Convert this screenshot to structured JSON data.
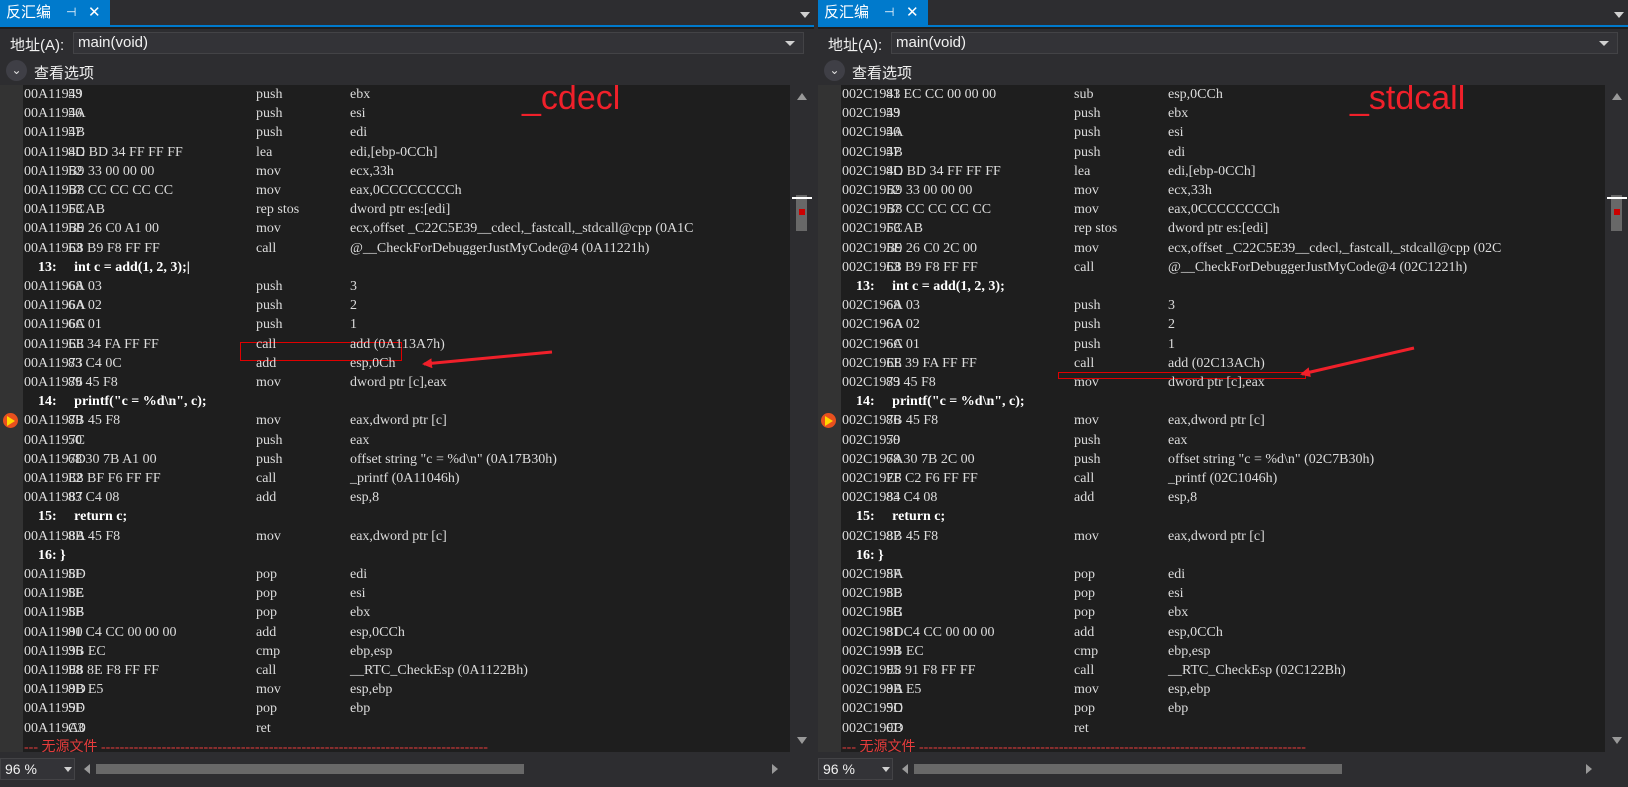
{
  "panes": [
    {
      "tab_title": "反汇编",
      "tab_pin": "⊣",
      "tab_close": "✕",
      "address_label": "地址(A):",
      "address_value": "main(void)",
      "view_options_label": "查看选项",
      "calling_convention": "_cdecl",
      "zoom": "96 %",
      "lines": [
        {
          "a": "00A11949",
          "b": "53",
          "m": "push",
          "o": "ebx"
        },
        {
          "a": "00A1194A",
          "b": "56",
          "m": "push",
          "o": "esi"
        },
        {
          "a": "00A1194B",
          "b": "57",
          "m": "push",
          "o": "edi"
        },
        {
          "a": "00A1194C",
          "b": "8D BD 34 FF FF FF",
          "m": "lea",
          "o": "edi,[ebp-0CCh]"
        },
        {
          "a": "00A11952",
          "b": "B9 33 00 00 00",
          "m": "mov",
          "o": "ecx,33h"
        },
        {
          "a": "00A11957",
          "b": "B8 CC CC CC CC",
          "m": "mov",
          "o": "eax,0CCCCCCCCh"
        },
        {
          "a": "00A1195C",
          "b": "F3 AB",
          "m": "rep stos",
          "o": "dword ptr es:[edi]"
        },
        {
          "a": "00A1195E",
          "b": "B9 26 C0 A1 00",
          "m": "mov",
          "o": "ecx,offset _C22C5E39__cdecl,_fastcall,_stdcall@cpp (0A1C"
        },
        {
          "a": "00A11963",
          "b": "E8 B9 F8 FF FF",
          "m": "call",
          "o": "@__CheckForDebuggerJustMyCode@4 (0A11221h)"
        },
        {
          "src": "    13:     int c = add(1, 2, 3);|"
        },
        {
          "a": "00A11968",
          "b": "6A 03",
          "m": "push",
          "o": "3"
        },
        {
          "a": "00A1196A",
          "b": "6A 02",
          "m": "push",
          "o": "2"
        },
        {
          "a": "00A1196C",
          "b": "6A 01",
          "m": "push",
          "o": "1"
        },
        {
          "a": "00A1196E",
          "b": "E8 34 FA FF FF",
          "m": "call",
          "o": "add (0A113A7h)"
        },
        {
          "a": "00A11973",
          "b": "83 C4 0C",
          "m": "add",
          "o": "esp,0Ch"
        },
        {
          "a": "00A11976",
          "b": "89 45 F8",
          "m": "mov",
          "o": "dword ptr [c],eax"
        },
        {
          "src": "    14:     printf(\"c = %d\\n\", c);"
        },
        {
          "a": "00A11979",
          "b": "8B 45 F8",
          "m": "mov",
          "o": "eax,dword ptr [c]",
          "bp": true
        },
        {
          "a": "00A1197C",
          "b": "50",
          "m": "push",
          "o": "eax"
        },
        {
          "a": "00A1197D",
          "b": "68 30 7B A1 00",
          "m": "push",
          "o": "offset string \"c = %d\\n\" (0A17B30h)"
        },
        {
          "a": "00A11982",
          "b": "E8 BF F6 FF FF",
          "m": "call",
          "o": "_printf (0A11046h)"
        },
        {
          "a": "00A11987",
          "b": "83 C4 08",
          "m": "add",
          "o": "esp,8"
        },
        {
          "src": "    15:     return c;"
        },
        {
          "a": "00A1198A",
          "b": "8B 45 F8",
          "m": "mov",
          "o": "eax,dword ptr [c]"
        },
        {
          "src": "    16: }"
        },
        {
          "a": "00A1198D",
          "b": "5F",
          "m": "pop",
          "o": "edi"
        },
        {
          "a": "00A1198E",
          "b": "5E",
          "m": "pop",
          "o": "esi"
        },
        {
          "a": "00A1198F",
          "b": "5B",
          "m": "pop",
          "o": "ebx"
        },
        {
          "a": "00A11990",
          "b": "81 C4 CC 00 00 00",
          "m": "add",
          "o": "esp,0CCh"
        },
        {
          "a": "00A11996",
          "b": "3B EC",
          "m": "cmp",
          "o": "ebp,esp"
        },
        {
          "a": "00A11998",
          "b": "E8 8E F8 FF FF",
          "m": "call",
          "o": "__RTC_CheckEsp (0A1122Bh)"
        },
        {
          "a": "00A1199D",
          "b": "8B E5",
          "m": "mov",
          "o": "esp,ebp"
        },
        {
          "a": "00A1199F",
          "b": "5D",
          "m": "pop",
          "o": "ebp"
        },
        {
          "a": "00A119A0",
          "b": "C3",
          "m": "ret",
          "o": ""
        },
        {
          "nosrc": "--- 无源文件 -----------------------------------------------------------------------------------"
        }
      ]
    },
    {
      "tab_title": "反汇编",
      "tab_pin": "⊣",
      "tab_close": "✕",
      "address_label": "地址(A):",
      "address_value": "main(void)",
      "view_options_label": "查看选项",
      "calling_convention": "_stdcall",
      "zoom": "96 %",
      "lines": [
        {
          "a": "002C1943",
          "b": "81 EC CC 00 00 00",
          "m": "sub",
          "o": "esp,0CCh"
        },
        {
          "a": "002C1949",
          "b": "53",
          "m": "push",
          "o": "ebx"
        },
        {
          "a": "002C194A",
          "b": "56",
          "m": "push",
          "o": "esi"
        },
        {
          "a": "002C194B",
          "b": "57",
          "m": "push",
          "o": "edi"
        },
        {
          "a": "002C194C",
          "b": "8D BD 34 FF FF FF",
          "m": "lea",
          "o": "edi,[ebp-0CCh]"
        },
        {
          "a": "002C1952",
          "b": "B9 33 00 00 00",
          "m": "mov",
          "o": "ecx,33h"
        },
        {
          "a": "002C1957",
          "b": "B8 CC CC CC CC",
          "m": "mov",
          "o": "eax,0CCCCCCCCh"
        },
        {
          "a": "002C195C",
          "b": "F3 AB",
          "m": "rep stos",
          "o": "dword ptr es:[edi]"
        },
        {
          "a": "002C195E",
          "b": "B9 26 C0 2C 00",
          "m": "mov",
          "o": "ecx,offset _C22C5E39__cdecl,_fastcall,_stdcall@cpp (02C"
        },
        {
          "a": "002C1963",
          "b": "E8 B9 F8 FF FF",
          "m": "call",
          "o": "@__CheckForDebuggerJustMyCode@4 (02C1221h)"
        },
        {
          "src": "    13:     int c = add(1, 2, 3);"
        },
        {
          "a": "002C1968",
          "b": "6A 03",
          "m": "push",
          "o": "3"
        },
        {
          "a": "002C196A",
          "b": "6A 02",
          "m": "push",
          "o": "2"
        },
        {
          "a": "002C196C",
          "b": "6A 01",
          "m": "push",
          "o": "1"
        },
        {
          "a": "002C196E",
          "b": "E8 39 FA FF FF",
          "m": "call",
          "o": "add (02C13ACh)"
        },
        {
          "a": "002C1973",
          "b": "89 45 F8",
          "m": "mov",
          "o": "dword ptr [c],eax"
        },
        {
          "src": "    14:     printf(\"c = %d\\n\", c);"
        },
        {
          "a": "002C1976",
          "b": "8B 45 F8",
          "m": "mov",
          "o": "eax,dword ptr [c]",
          "bp": true
        },
        {
          "a": "002C1979",
          "b": "50",
          "m": "push",
          "o": "eax"
        },
        {
          "a": "002C197A",
          "b": "68 30 7B 2C 00",
          "m": "push",
          "o": "offset string \"c = %d\\n\" (02C7B30h)"
        },
        {
          "a": "002C197F",
          "b": "E8 C2 F6 FF FF",
          "m": "call",
          "o": "_printf (02C1046h)"
        },
        {
          "a": "002C1984",
          "b": "83 C4 08",
          "m": "add",
          "o": "esp,8"
        },
        {
          "src": "    15:     return c;"
        },
        {
          "a": "002C1987",
          "b": "8B 45 F8",
          "m": "mov",
          "o": "eax,dword ptr [c]"
        },
        {
          "src": "    16: }"
        },
        {
          "a": "002C198A",
          "b": "5F",
          "m": "pop",
          "o": "edi"
        },
        {
          "a": "002C198B",
          "b": "5E",
          "m": "pop",
          "o": "esi"
        },
        {
          "a": "002C198C",
          "b": "5B",
          "m": "pop",
          "o": "ebx"
        },
        {
          "a": "002C198D",
          "b": "81 C4 CC 00 00 00",
          "m": "add",
          "o": "esp,0CCh"
        },
        {
          "a": "002C1993",
          "b": "3B EC",
          "m": "cmp",
          "o": "ebp,esp"
        },
        {
          "a": "002C1995",
          "b": "E8 91 F8 FF FF",
          "m": "call",
          "o": "__RTC_CheckEsp (02C122Bh)"
        },
        {
          "a": "002C199A",
          "b": "8B E5",
          "m": "mov",
          "o": "esp,ebp"
        },
        {
          "a": "002C199C",
          "b": "5D",
          "m": "pop",
          "o": "ebp"
        },
        {
          "a": "002C199D",
          "b": "C3",
          "m": "ret",
          "o": ""
        },
        {
          "nosrc": "--- 无源文件 -----------------------------------------------------------------------------------"
        }
      ]
    }
  ],
  "colors": {
    "accent": "#007acc",
    "annotation_red": "#f0202a",
    "background": "#1e1e1e"
  }
}
